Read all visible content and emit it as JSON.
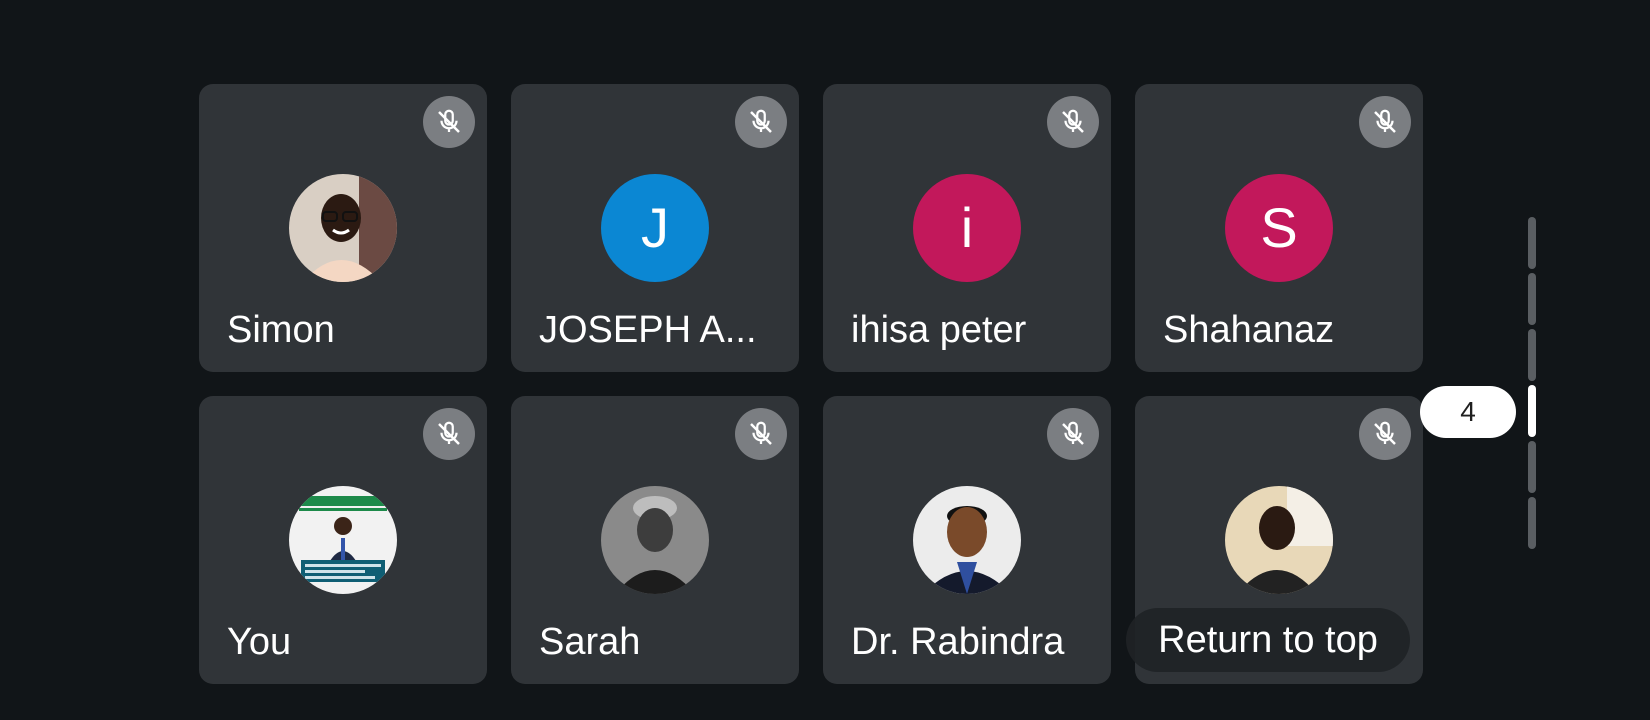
{
  "participants": [
    {
      "name": "Simon",
      "avatar_type": "photo",
      "avatar_icon": "man-glasses-photo",
      "muted": true
    },
    {
      "name": "JOSEPH A...",
      "avatar_type": "initial",
      "initial": "J",
      "color": "#0b87d3",
      "muted": true
    },
    {
      "name": "ihisa peter",
      "avatar_type": "initial",
      "initial": "i",
      "color": "#c2185b",
      "muted": true
    },
    {
      "name": "Shahanaz",
      "avatar_type": "initial",
      "initial": "S",
      "color": "#c2185b",
      "muted": true
    },
    {
      "name": "You",
      "avatar_type": "photo",
      "avatar_icon": "poster-photo",
      "muted": true
    },
    {
      "name": "Sarah",
      "avatar_type": "photo",
      "avatar_icon": "grayscale-woman-photo",
      "muted": true
    },
    {
      "name": "Dr. Rabindra",
      "avatar_type": "photo",
      "avatar_icon": "man-suit-photo",
      "muted": true
    },
    {
      "name": "",
      "avatar_type": "photo",
      "avatar_icon": "man-photo",
      "muted": true
    }
  ],
  "mic_icon": "mic-off-icon",
  "pagination": {
    "current_page": "4",
    "total_segments": 6,
    "active_segment_index": 3
  },
  "return_to_top_label": "Return to top",
  "colors": {
    "background": "#111518",
    "tile": "#303438",
    "mic_bg": "#7b7e82"
  }
}
